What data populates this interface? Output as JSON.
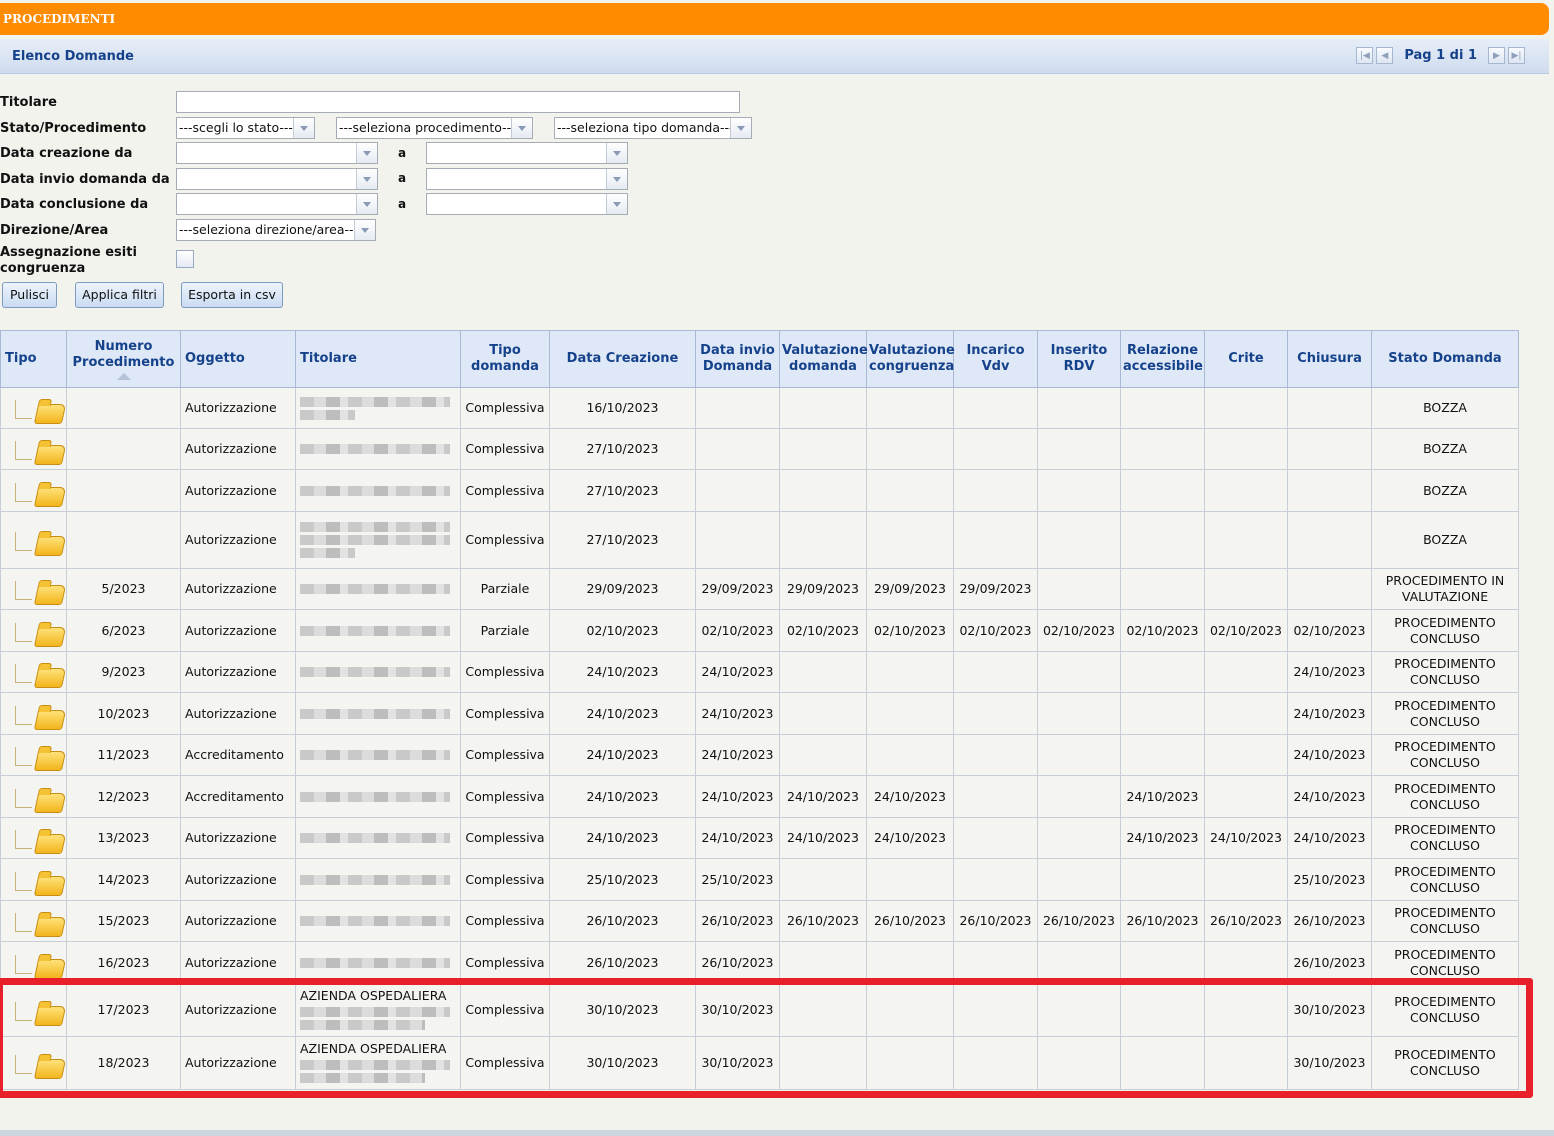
{
  "header": {
    "title": "PROCEDIMENTI"
  },
  "subheader": {
    "title": "Elenco Domande",
    "pager_label": "Pag 1 di 1"
  },
  "filters": {
    "titolare_label": "Titolare",
    "stato_label": "Stato/Procedimento",
    "stato_select": "---scegli lo stato---",
    "procedimento_select": "---seleziona procedimento---",
    "tipo_domanda_select": "---seleziona tipo domanda---",
    "data_creazione_label": "Data creazione da",
    "data_invio_label": "Data invio domanda da",
    "data_conclusione_label": "Data conclusione da",
    "range_sep": "a",
    "direzione_label": "Direzione/Area",
    "direzione_select": "---seleziona direzione/area---",
    "assegnazione_label_1": "Assegnazione esiti",
    "assegnazione_label_2": "congruenza"
  },
  "buttons": {
    "pulisci": "Pulisci",
    "applica": "Applica filtri",
    "esporta": "Esporta in csv"
  },
  "table": {
    "headers": {
      "tipo": "Tipo",
      "numero_1": "Numero",
      "numero_2": "Procedimento",
      "oggetto": "Oggetto",
      "titolare": "Titolare",
      "tipo_domanda_1": "Tipo",
      "tipo_domanda_2": "domanda",
      "data_creazione": "Data Creazione",
      "data_invio_1": "Data invio",
      "data_invio_2": "Domanda",
      "val_dom_1": "Valutazione",
      "val_dom_2": "domanda",
      "val_cong_1": "Valutazione",
      "val_cong_2": "congruenza",
      "incarico_1": "Incarico",
      "incarico_2": "Vdv",
      "inserito_1": "Inserito",
      "inserito_2": "RDV",
      "relazione_1": "Relazione",
      "relazione_2": "accessibile",
      "crite": "Crite",
      "chiusura": "Chiusura",
      "stato": "Stato Domanda"
    },
    "rows": [
      {
        "num": "",
        "ogg": "Autorizzazione",
        "tit": "",
        "tipo": "Complessiva",
        "crea": "16/10/2023",
        "invio": "",
        "vd": "",
        "vc": "",
        "inc": "",
        "ins": "",
        "rel": "",
        "crite": "",
        "chi": "",
        "stato": "BOZZA"
      },
      {
        "num": "",
        "ogg": "Autorizzazione",
        "tit": "",
        "tipo": "Complessiva",
        "crea": "27/10/2023",
        "invio": "",
        "vd": "",
        "vc": "",
        "inc": "",
        "ins": "",
        "rel": "",
        "crite": "",
        "chi": "",
        "stato": "BOZZA"
      },
      {
        "num": "",
        "ogg": "Autorizzazione",
        "tit": "",
        "tipo": "Complessiva",
        "crea": "27/10/2023",
        "invio": "",
        "vd": "",
        "vc": "",
        "inc": "",
        "ins": "",
        "rel": "",
        "crite": "",
        "chi": "",
        "stato": "BOZZA"
      },
      {
        "num": "",
        "ogg": "Autorizzazione",
        "tit": "",
        "tipo": "Complessiva",
        "crea": "27/10/2023",
        "invio": "",
        "vd": "",
        "vc": "",
        "inc": "",
        "ins": "",
        "rel": "",
        "crite": "",
        "chi": "",
        "stato": "BOZZA"
      },
      {
        "num": "5/2023",
        "ogg": "Autorizzazione",
        "tit": "",
        "tipo": "Parziale",
        "crea": "29/09/2023",
        "invio": "29/09/2023",
        "vd": "29/09/2023",
        "vc": "29/09/2023",
        "inc": "29/09/2023",
        "ins": "",
        "rel": "",
        "crite": "",
        "chi": "",
        "stato": "PROCEDIMENTO IN VALUTAZIONE"
      },
      {
        "num": "6/2023",
        "ogg": "Autorizzazione",
        "tit": "",
        "tipo": "Parziale",
        "crea": "02/10/2023",
        "invio": "02/10/2023",
        "vd": "02/10/2023",
        "vc": "02/10/2023",
        "inc": "02/10/2023",
        "ins": "02/10/2023",
        "rel": "02/10/2023",
        "crite": "02/10/2023",
        "chi": "02/10/2023",
        "stato": "PROCEDIMENTO CONCLUSO"
      },
      {
        "num": "9/2023",
        "ogg": "Autorizzazione",
        "tit": "",
        "tipo": "Complessiva",
        "crea": "24/10/2023",
        "invio": "24/10/2023",
        "vd": "",
        "vc": "",
        "inc": "",
        "ins": "",
        "rel": "",
        "crite": "",
        "chi": "24/10/2023",
        "stato": "PROCEDIMENTO CONCLUSO"
      },
      {
        "num": "10/2023",
        "ogg": "Autorizzazione",
        "tit": "",
        "tipo": "Complessiva",
        "crea": "24/10/2023",
        "invio": "24/10/2023",
        "vd": "",
        "vc": "",
        "inc": "",
        "ins": "",
        "rel": "",
        "crite": "",
        "chi": "24/10/2023",
        "stato": "PROCEDIMENTO CONCLUSO"
      },
      {
        "num": "11/2023",
        "ogg": "Accreditamento",
        "tit": "",
        "tipo": "Complessiva",
        "crea": "24/10/2023",
        "invio": "24/10/2023",
        "vd": "",
        "vc": "",
        "inc": "",
        "ins": "",
        "rel": "",
        "crite": "",
        "chi": "24/10/2023",
        "stato": "PROCEDIMENTO CONCLUSO"
      },
      {
        "num": "12/2023",
        "ogg": "Accreditamento",
        "tit": "",
        "tipo": "Complessiva",
        "crea": "24/10/2023",
        "invio": "24/10/2023",
        "vd": "24/10/2023",
        "vc": "24/10/2023",
        "inc": "",
        "ins": "",
        "rel": "24/10/2023",
        "crite": "",
        "chi": "24/10/2023",
        "stato": "PROCEDIMENTO CONCLUSO"
      },
      {
        "num": "13/2023",
        "ogg": "Autorizzazione",
        "tit": "",
        "tipo": "Complessiva",
        "crea": "24/10/2023",
        "invio": "24/10/2023",
        "vd": "24/10/2023",
        "vc": "24/10/2023",
        "inc": "",
        "ins": "",
        "rel": "24/10/2023",
        "crite": "24/10/2023",
        "chi": "24/10/2023",
        "stato": "PROCEDIMENTO CONCLUSO"
      },
      {
        "num": "14/2023",
        "ogg": "Autorizzazione",
        "tit": "",
        "tipo": "Complessiva",
        "crea": "25/10/2023",
        "invio": "25/10/2023",
        "vd": "",
        "vc": "",
        "inc": "",
        "ins": "",
        "rel": "",
        "crite": "",
        "chi": "25/10/2023",
        "stato": "PROCEDIMENTO CONCLUSO"
      },
      {
        "num": "15/2023",
        "ogg": "Autorizzazione",
        "tit": "",
        "tipo": "Complessiva",
        "crea": "26/10/2023",
        "invio": "26/10/2023",
        "vd": "26/10/2023",
        "vc": "26/10/2023",
        "inc": "26/10/2023",
        "ins": "26/10/2023",
        "rel": "26/10/2023",
        "crite": "26/10/2023",
        "chi": "26/10/2023",
        "stato": "PROCEDIMENTO CONCLUSO"
      },
      {
        "num": "16/2023",
        "ogg": "Autorizzazione",
        "tit": "",
        "tipo": "Complessiva",
        "crea": "26/10/2023",
        "invio": "26/10/2023",
        "vd": "",
        "vc": "",
        "inc": "",
        "ins": "",
        "rel": "",
        "crite": "",
        "chi": "26/10/2023",
        "stato": "PROCEDIMENTO CONCLUSO"
      },
      {
        "num": "17/2023",
        "ogg": "Autorizzazione",
        "tit": "AZIENDA OSPEDALIERA",
        "tipo": "Complessiva",
        "crea": "30/10/2023",
        "invio": "30/10/2023",
        "vd": "",
        "vc": "",
        "inc": "",
        "ins": "",
        "rel": "",
        "crite": "",
        "chi": "30/10/2023",
        "stato": "PROCEDIMENTO CONCLUSO"
      },
      {
        "num": "18/2023",
        "ogg": "Autorizzazione",
        "tit": "AZIENDA OSPEDALIERA",
        "tipo": "Complessiva",
        "crea": "30/10/2023",
        "invio": "30/10/2023",
        "vd": "",
        "vc": "",
        "inc": "",
        "ins": "",
        "rel": "",
        "crite": "",
        "chi": "30/10/2023",
        "stato": "PROCEDIMENTO CONCLUSO"
      }
    ]
  },
  "colors": {
    "header_orange": "#ff8c00",
    "header_blue_text": "#15428b",
    "highlight_red": "#e8202a"
  },
  "icons": {
    "row_type": "folder-icon",
    "pager": [
      "first-page-icon",
      "prev-page-icon",
      "next-page-icon",
      "last-page-icon"
    ]
  }
}
